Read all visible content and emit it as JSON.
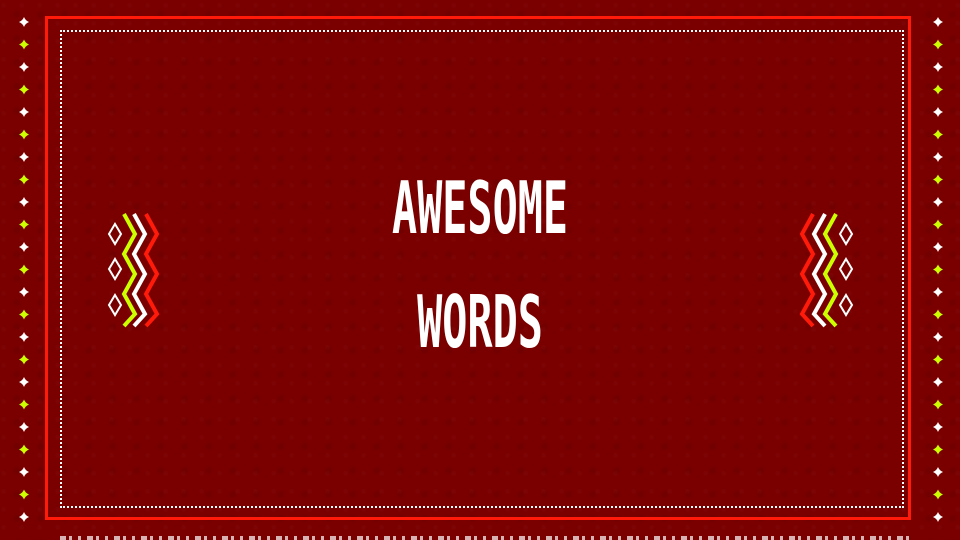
{
  "title": {
    "line1": "AWESOME",
    "line2": "WORDS"
  },
  "colors": {
    "background": "#7a0000",
    "frame_red": "#ff1a0a",
    "text_white": "#ffffff",
    "accent_lime": "#ccff00"
  },
  "icons": [
    "sparkle-icon",
    "diamond-icon",
    "zigzag-ornament"
  ]
}
